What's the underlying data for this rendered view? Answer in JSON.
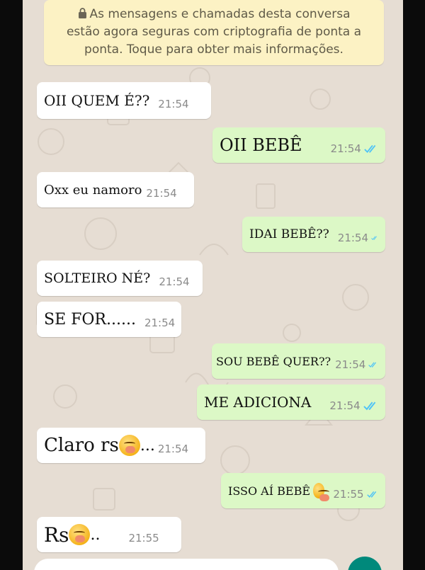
{
  "encryption_notice": {
    "line1": "As mensagens e chamadas desta conversa",
    "line2": "estão agora seguras com criptografia de ponta a",
    "line3": "ponta. Toque para obter mais informações."
  },
  "messages": [
    {
      "direction": "incoming",
      "text": "OII QUEM É??",
      "time": "21:54"
    },
    {
      "direction": "outgoing",
      "text": "OII BEBÊ",
      "time": "21:54",
      "status": "read"
    },
    {
      "direction": "incoming",
      "text": "Oxx eu namoro",
      "time": "21:54"
    },
    {
      "direction": "outgoing",
      "text": "IDAI BEBÊ??",
      "time": "21:54",
      "status": "read"
    },
    {
      "direction": "incoming",
      "text": "SOLTEIRO NÉ?",
      "time": "21:54"
    },
    {
      "direction": "incoming",
      "text": "SE FOR......",
      "time": "21:54"
    },
    {
      "direction": "outgoing",
      "text": "SOU BEBÊ QUER??",
      "time": "21:54",
      "status": "read"
    },
    {
      "direction": "outgoing",
      "text": "ME ADICIONA",
      "time": "21:54",
      "status": "read"
    },
    {
      "direction": "incoming",
      "text_before": "Claro rs",
      "emoji": "hand-over-mouth-emoji",
      "text_after": "...",
      "time": "21:54"
    },
    {
      "direction": "outgoing",
      "text_before": "ISSO AÍ BEBÊ",
      "emoji": "kissing-heart-emoji",
      "text_after": "",
      "time": "21:55",
      "status": "read"
    },
    {
      "direction": "incoming",
      "text_before": "Rs",
      "emoji": "hand-over-mouth-emoji",
      "text_after": "..",
      "time": "21:55"
    }
  ],
  "colors": {
    "chat_background": "#e6ddd3",
    "incoming_bubble": "#ffffff",
    "outgoing_bubble": "#dcf8c6",
    "read_ticks": "#4fc3f7",
    "notice_background": "#fcf2c4",
    "fab": "#00897b"
  },
  "icons": [
    "lock-icon",
    "double-check-icon",
    "hand-over-mouth-emoji",
    "kissing-heart-emoji"
  ]
}
